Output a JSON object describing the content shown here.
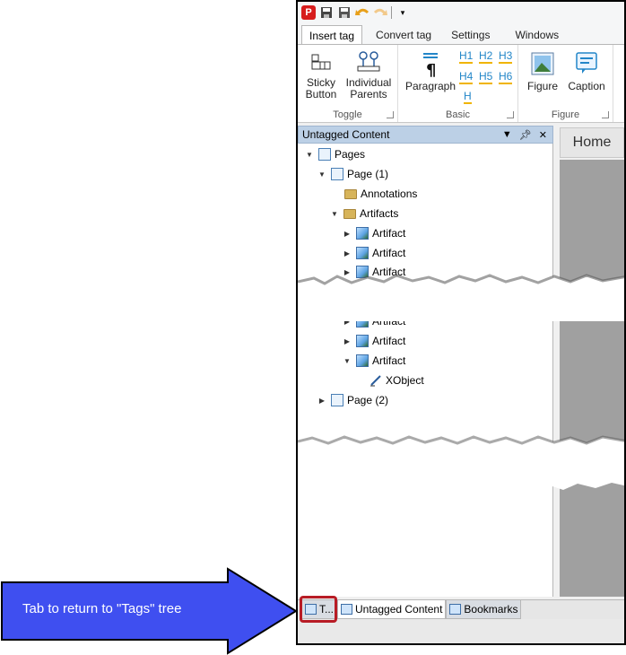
{
  "ribbon": {
    "tabs": [
      "Insert tag",
      "Convert tag",
      "Settings",
      "Windows"
    ],
    "groups": {
      "toggle": {
        "label": "Toggle",
        "sticky": [
          "Sticky",
          "Button"
        ],
        "individual": [
          "Individual",
          "Parents"
        ]
      },
      "basic": {
        "label": "Basic",
        "paragraph": "Paragraph",
        "headings": [
          "H1",
          "H2",
          "H3",
          "H4",
          "H5",
          "H6",
          "H"
        ]
      },
      "figure": {
        "label": "Figure",
        "figure_btn": "Figure",
        "caption_btn": "Caption"
      }
    }
  },
  "panel": {
    "title": "Untagged Content",
    "tree": [
      {
        "label": "Pages"
      },
      {
        "label": "Page (1)"
      },
      {
        "label": "Annotations"
      },
      {
        "label": "Artifacts"
      },
      {
        "label": "Artifact"
      },
      {
        "label": "Artifact"
      },
      {
        "label": "Artifact"
      },
      {
        "label": "Artifact"
      },
      {
        "label": "Artifact"
      },
      {
        "label": "Artifact"
      },
      {
        "label": "XObject"
      },
      {
        "label": "Page (2)"
      }
    ]
  },
  "document": {
    "tab": "Home"
  },
  "bottom_tabs": [
    "T...",
    "Untagged Content",
    "Bookmarks"
  ],
  "callout": {
    "text": "Tab to return to \"Tags\" tree",
    "color": "#3f4ff0"
  },
  "colors": {
    "highlight": "#b81c25",
    "panel_title": "#bcd0e6",
    "canvas": "#a0a0a0"
  }
}
